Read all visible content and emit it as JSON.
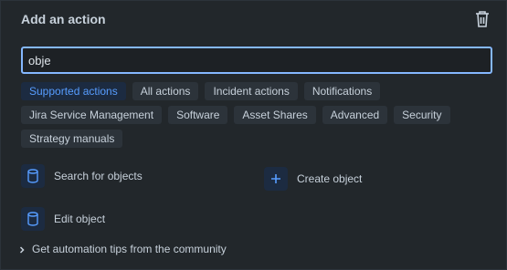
{
  "dialog": {
    "title": "Add an action",
    "delete_icon": "trash-icon"
  },
  "search": {
    "value": "obje"
  },
  "filters": {
    "row1": [
      "Supported actions",
      "All actions",
      "Incident actions",
      "Notifications"
    ],
    "row2": [
      "Jira Service Management",
      "Software",
      "Asset Shares",
      "Advanced",
      "Security"
    ],
    "row3": [
      "Strategy manuals"
    ],
    "selected": "Supported actions"
  },
  "actions": {
    "search_objects": {
      "label": "Search for objects",
      "icon": "database-icon"
    },
    "create_object": {
      "label": "Create object",
      "icon": "plus-icon"
    },
    "edit_object": {
      "label": "Edit object",
      "icon": "database-icon"
    }
  },
  "footer": {
    "tips_label": "Get automation tips from the community"
  },
  "colors": {
    "background": "#22272b",
    "accent": "#579dff",
    "focus_border": "#85b8ff",
    "chip_bg": "#2c333a",
    "chip_selected_bg": "#1c2b41"
  }
}
